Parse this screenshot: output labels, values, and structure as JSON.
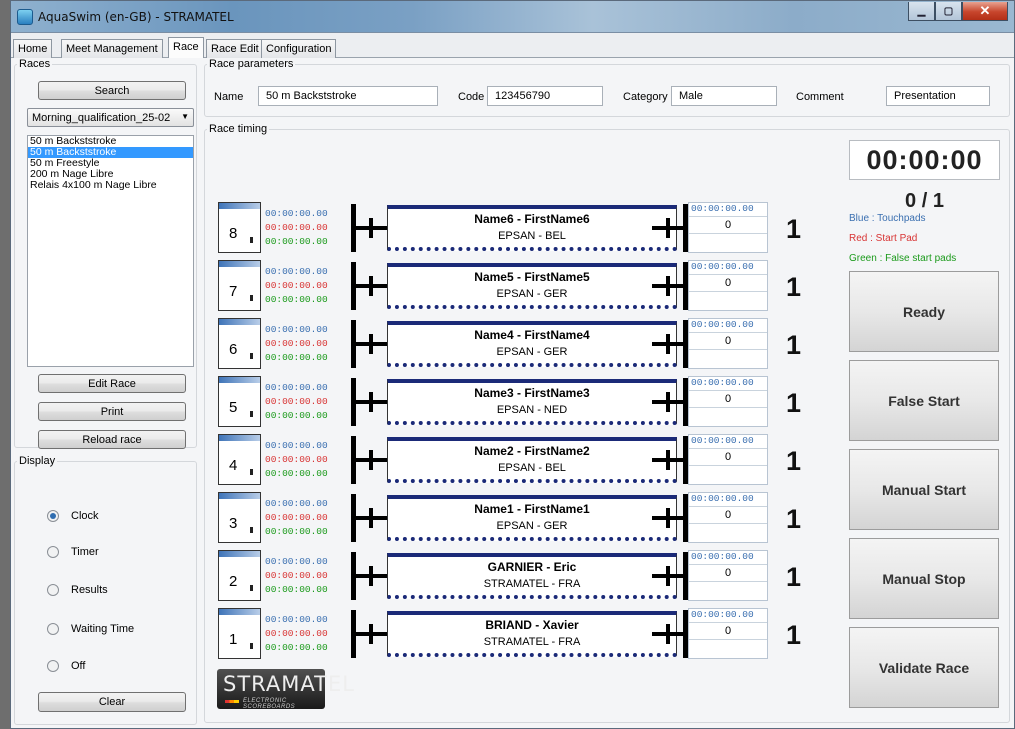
{
  "window": {
    "title": "AquaSwim (en-GB) - STRAMATEL"
  },
  "tabs": [
    "Home",
    "Meet Management",
    "Race",
    "Race Edit",
    "Configuration"
  ],
  "races": {
    "legend": "Races",
    "search_label": "Search",
    "meet_selected": "Morning_qualification_25-02",
    "list": [
      "50 m Backststroke",
      "50 m Backststroke",
      "50 m Freestyle",
      "200 m Nage Libre",
      "Relais 4x100 m Nage Libre"
    ],
    "edit_label": "Edit Race",
    "print_label": "Print",
    "reload_label": "Reload race"
  },
  "display": {
    "legend": "Display",
    "options": [
      "Clock",
      "Timer",
      "Results",
      "Waiting Time",
      "Off"
    ],
    "selected": "Clock",
    "clear_label": "Clear"
  },
  "params": {
    "legend": "Race parameters",
    "name_label": "Name",
    "name_value": "50 m Backststroke",
    "code_label": "Code",
    "code_value": "123456790",
    "category_label": "Category",
    "category_value": "Male",
    "comment_label": "Comment",
    "comment_value": "Presentation"
  },
  "timing": {
    "legend": "Race timing",
    "clock": "00:00:00",
    "counter": "0 / 1",
    "legend_blue": "Blue : Touchpads",
    "legend_red": "Red : Start Pad",
    "legend_green": "Green  : False start pads",
    "colors": {
      "blue": "#3a6fb0",
      "red": "#d83434",
      "green": "#1b9a1b"
    },
    "buttons": [
      "Ready",
      "False Start",
      "Manual Start",
      "Manual Stop",
      "Validate Race"
    ]
  },
  "lanes": [
    {
      "lane": "8",
      "t_blue": "00:00:00.00",
      "t_red": "00:00:00.00",
      "t_green": "00:00:00.00",
      "name": "Name6 - FirstName6",
      "club": "EPSAN - BEL",
      "result_time": "00:00:00.00",
      "result_value": "0",
      "place": "1"
    },
    {
      "lane": "7",
      "t_blue": "00:00:00.00",
      "t_red": "00:00:00.00",
      "t_green": "00:00:00.00",
      "name": "Name5 - FirstName5",
      "club": "EPSAN - GER",
      "result_time": "00:00:00.00",
      "result_value": "0",
      "place": "1"
    },
    {
      "lane": "6",
      "t_blue": "00:00:00.00",
      "t_red": "00:00:00.00",
      "t_green": "00:00:00.00",
      "name": "Name4 - FirstName4",
      "club": "EPSAN - GER",
      "result_time": "00:00:00.00",
      "result_value": "0",
      "place": "1"
    },
    {
      "lane": "5",
      "t_blue": "00:00:00.00",
      "t_red": "00:00:00.00",
      "t_green": "00:00:00.00",
      "name": "Name3 - FirstName3",
      "club": "EPSAN - NED",
      "result_time": "00:00:00.00",
      "result_value": "0",
      "place": "1"
    },
    {
      "lane": "4",
      "t_blue": "00:00:00.00",
      "t_red": "00:00:00.00",
      "t_green": "00:00:00.00",
      "name": "Name2 - FirstName2",
      "club": "EPSAN - BEL",
      "result_time": "00:00:00.00",
      "result_value": "0",
      "place": "1"
    },
    {
      "lane": "3",
      "t_blue": "00:00:00.00",
      "t_red": "00:00:00.00",
      "t_green": "00:00:00.00",
      "name": "Name1 - FirstName1",
      "club": "EPSAN - GER",
      "result_time": "00:00:00.00",
      "result_value": "0",
      "place": "1"
    },
    {
      "lane": "2",
      "t_blue": "00:00:00.00",
      "t_red": "00:00:00.00",
      "t_green": "00:00:00.00",
      "name": "GARNIER - Eric",
      "club": "STRAMATEL - FRA",
      "result_time": "00:00:00.00",
      "result_value": "0",
      "place": "1"
    },
    {
      "lane": "1",
      "t_blue": "00:00:00.00",
      "t_red": "00:00:00.00",
      "t_green": "00:00:00.00",
      "name": "BRIAND - Xavier",
      "club": "STRAMATEL - FRA",
      "result_time": "00:00:00.00",
      "result_value": "0",
      "place": "1"
    }
  ],
  "logo": {
    "wordmark": "STRAMATEL",
    "tagline": "ELECTRONIC SCOREBOARDS"
  }
}
